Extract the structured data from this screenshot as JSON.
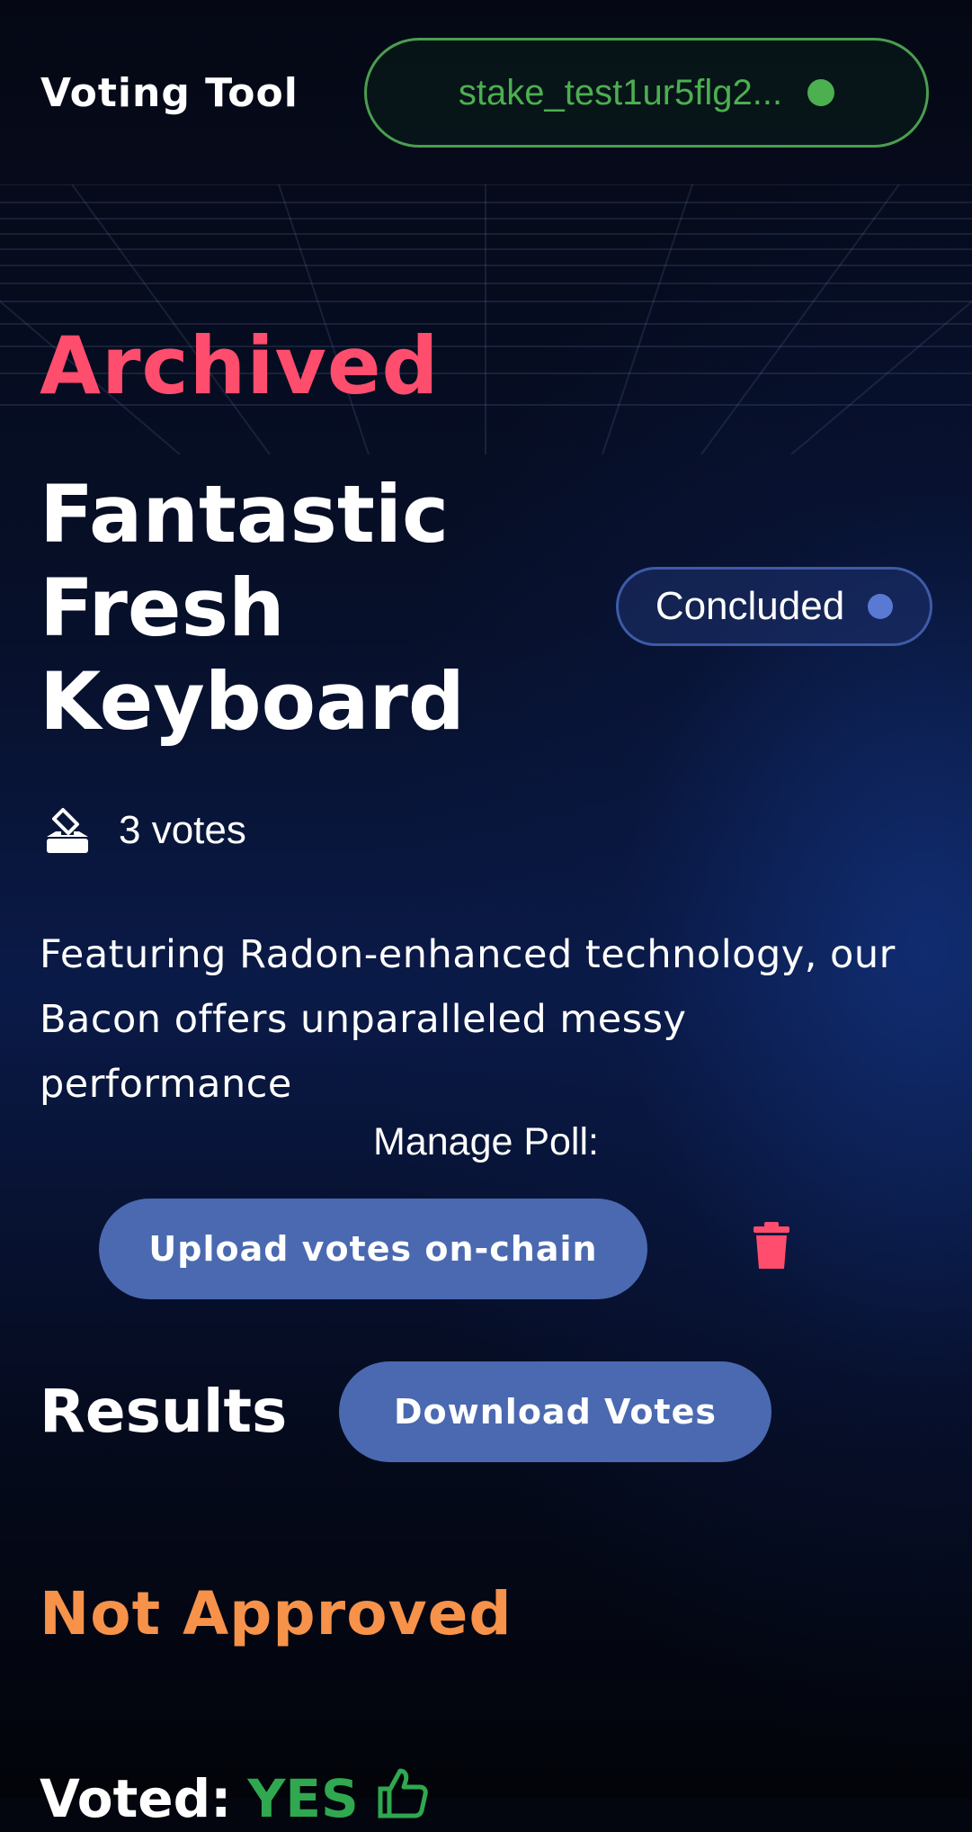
{
  "header": {
    "app_title": "Voting Tool",
    "wallet_address": "stake_test1ur5flg2...",
    "wallet_status_color": "#4caf50"
  },
  "poll": {
    "section_status": "Archived",
    "title": "Fantastic Fresh Keyboard",
    "status_badge": "Concluded",
    "votes_count_text": "3 votes",
    "description": "Featuring Radon-enhanced technology, our Bacon offers unparalleled messy performance"
  },
  "manage": {
    "label": "Manage Poll:",
    "upload_button": "Upload votes on-chain",
    "delete_icon": "trash-icon"
  },
  "results": {
    "heading": "Results",
    "download_button": "Download Votes",
    "outcome": "Not Approved",
    "voted_label": "Voted:",
    "voted_value": "YES",
    "voted_icon": "thumbs-up-icon"
  },
  "colors": {
    "archived": "#ff4d6d",
    "not_approved": "#f7924a",
    "button": "#4a69b0",
    "yes": "#2fa84f"
  }
}
